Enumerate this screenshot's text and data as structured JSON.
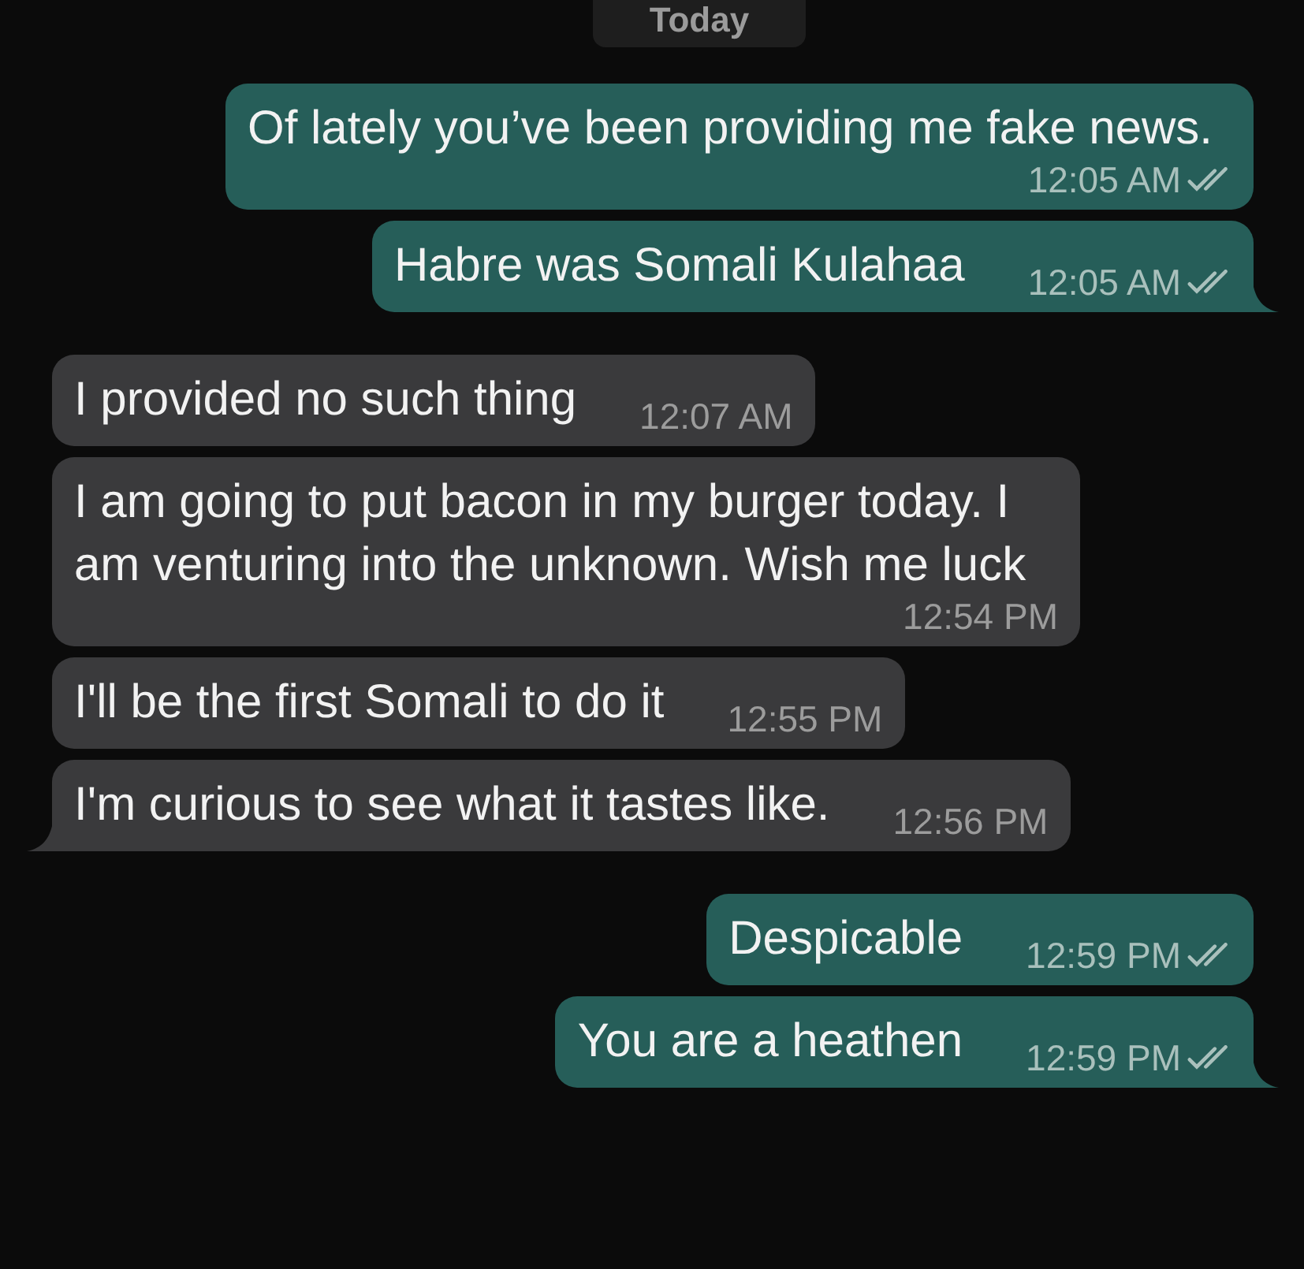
{
  "day_label": "Today",
  "messages": [
    {
      "kind": "outgoing",
      "text": "Of lately you’ve been providing me fake news.",
      "time": "12:05 AM",
      "read": false,
      "tail": false
    },
    {
      "kind": "outgoing",
      "text": "Habre was Somali Kulahaa",
      "time": "12:05 AM",
      "read": false,
      "tail": true
    },
    {
      "kind": "incoming",
      "text": "I provided no such thing",
      "time": "12:07 AM",
      "tail": false
    },
    {
      "kind": "incoming",
      "text": "I am going to put bacon in my burger today. I am venturing into the unknown. Wish me luck",
      "time": "12:54 PM",
      "tail": false
    },
    {
      "kind": "incoming",
      "text": "I'll be the first Somali to do it",
      "time": "12:55 PM",
      "tail": false
    },
    {
      "kind": "incoming",
      "text": "I'm curious to see what it tastes like.",
      "time": "12:56 PM",
      "tail": true
    },
    {
      "kind": "outgoing",
      "text": "Despicable",
      "time": "12:59 PM",
      "read": false,
      "tail": false
    },
    {
      "kind": "outgoing",
      "text": "You are a heathen",
      "time": "12:59 PM",
      "read": false,
      "tail": true
    }
  ]
}
